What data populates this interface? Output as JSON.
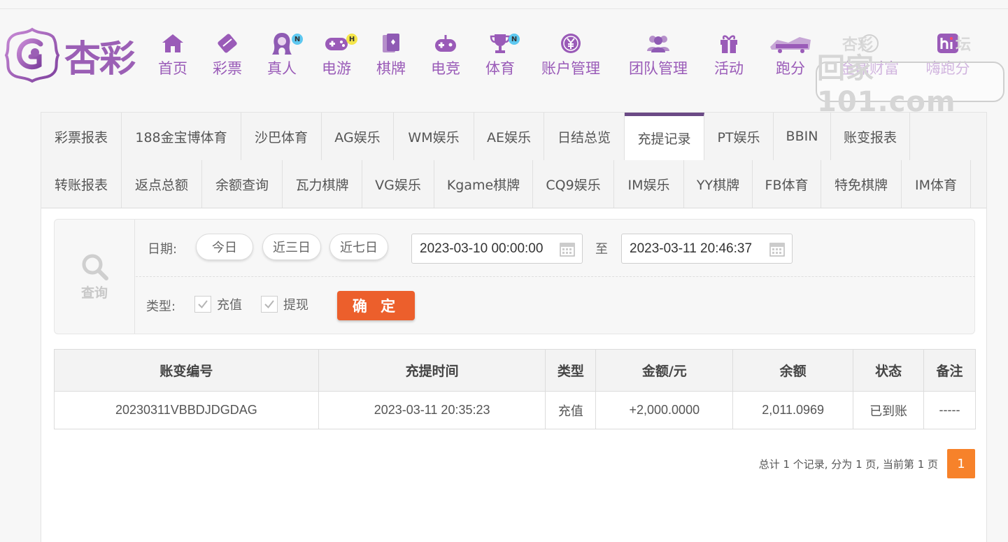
{
  "brand": {
    "logo_text": "杏彩"
  },
  "nav": [
    {
      "label": "首页",
      "icon": "home-icon",
      "badge": ""
    },
    {
      "label": "彩票",
      "icon": "lottery-ticket-icon",
      "badge": ""
    },
    {
      "label": "真人",
      "icon": "live-dealer-icon",
      "badge": "N"
    },
    {
      "label": "电游",
      "icon": "gamepad-icon",
      "badge": "H"
    },
    {
      "label": "棋牌",
      "icon": "cards-icon",
      "badge": ""
    },
    {
      "label": "电竞",
      "icon": "esports-controller-icon",
      "badge": ""
    },
    {
      "label": "体育",
      "icon": "trophy-icon",
      "badge": "N"
    },
    {
      "label": "账户管理",
      "icon": "yuan-coin-icon",
      "badge": ""
    },
    {
      "label": "团队管理",
      "icon": "team-icon",
      "badge": ""
    },
    {
      "label": "活动",
      "icon": "gift-icon",
      "badge": ""
    },
    {
      "label": "跑分",
      "icon": "running-icon",
      "badge": ""
    },
    {
      "label": "金鼎财富",
      "icon": "wealth-icon",
      "badge": ""
    },
    {
      "label": "嗨跑分",
      "icon": "hi-icon",
      "badge": ""
    }
  ],
  "watermark": {
    "text": "回家101.com",
    "top_left": "杏彩",
    "top_right": "坛"
  },
  "tabs_row1": [
    "彩票报表",
    "188金宝博体育",
    "沙巴体育",
    "AG娱乐",
    "WM娱乐",
    "AE娱乐",
    "日结总览",
    "充提记录",
    "PT娱乐",
    "BBIN",
    "账变报表"
  ],
  "tabs_row2": [
    "转账报表",
    "返点总额",
    "余额查询",
    "瓦力棋牌",
    "VG娱乐",
    "Kgame棋牌",
    "CQ9娱乐",
    "IM娱乐",
    "YY棋牌",
    "FB体育",
    "特免棋牌",
    "IM体育"
  ],
  "active_tab": "充提记录",
  "query": {
    "side_label": "查询",
    "date_label": "日期:",
    "quick": [
      "今日",
      "近三日",
      "近七日"
    ],
    "start": "2023-03-10 00:00:00",
    "to_label": "至",
    "end": "2023-03-11 20:46:37",
    "type_label": "类型:",
    "types": [
      {
        "label": "充值",
        "checked": true
      },
      {
        "label": "提现",
        "checked": true
      }
    ],
    "confirm_label": "确 定"
  },
  "table": {
    "headers": [
      "账变编号",
      "充提时间",
      "类型",
      "金额/元",
      "余额",
      "状态",
      "备注"
    ],
    "rows": [
      {
        "id": "20230311VBBDJDGDAG",
        "time": "2023-03-11 20:35:23",
        "type": "充值",
        "amount": "+2,000.0000",
        "balance": "2,011.0969",
        "status": "已到账",
        "remark": "-----"
      }
    ]
  },
  "pager": {
    "info": "总计 1 个记录, 分为 1 页, 当前第 1 页",
    "current": "1"
  },
  "colors": {
    "brand_purple": "#9a5bb8",
    "accent_orange": "#ec5f2c",
    "amount_red": "#c0121b",
    "status_green": "#3a9a2c",
    "active_tab_bar": "#6b4a86"
  }
}
